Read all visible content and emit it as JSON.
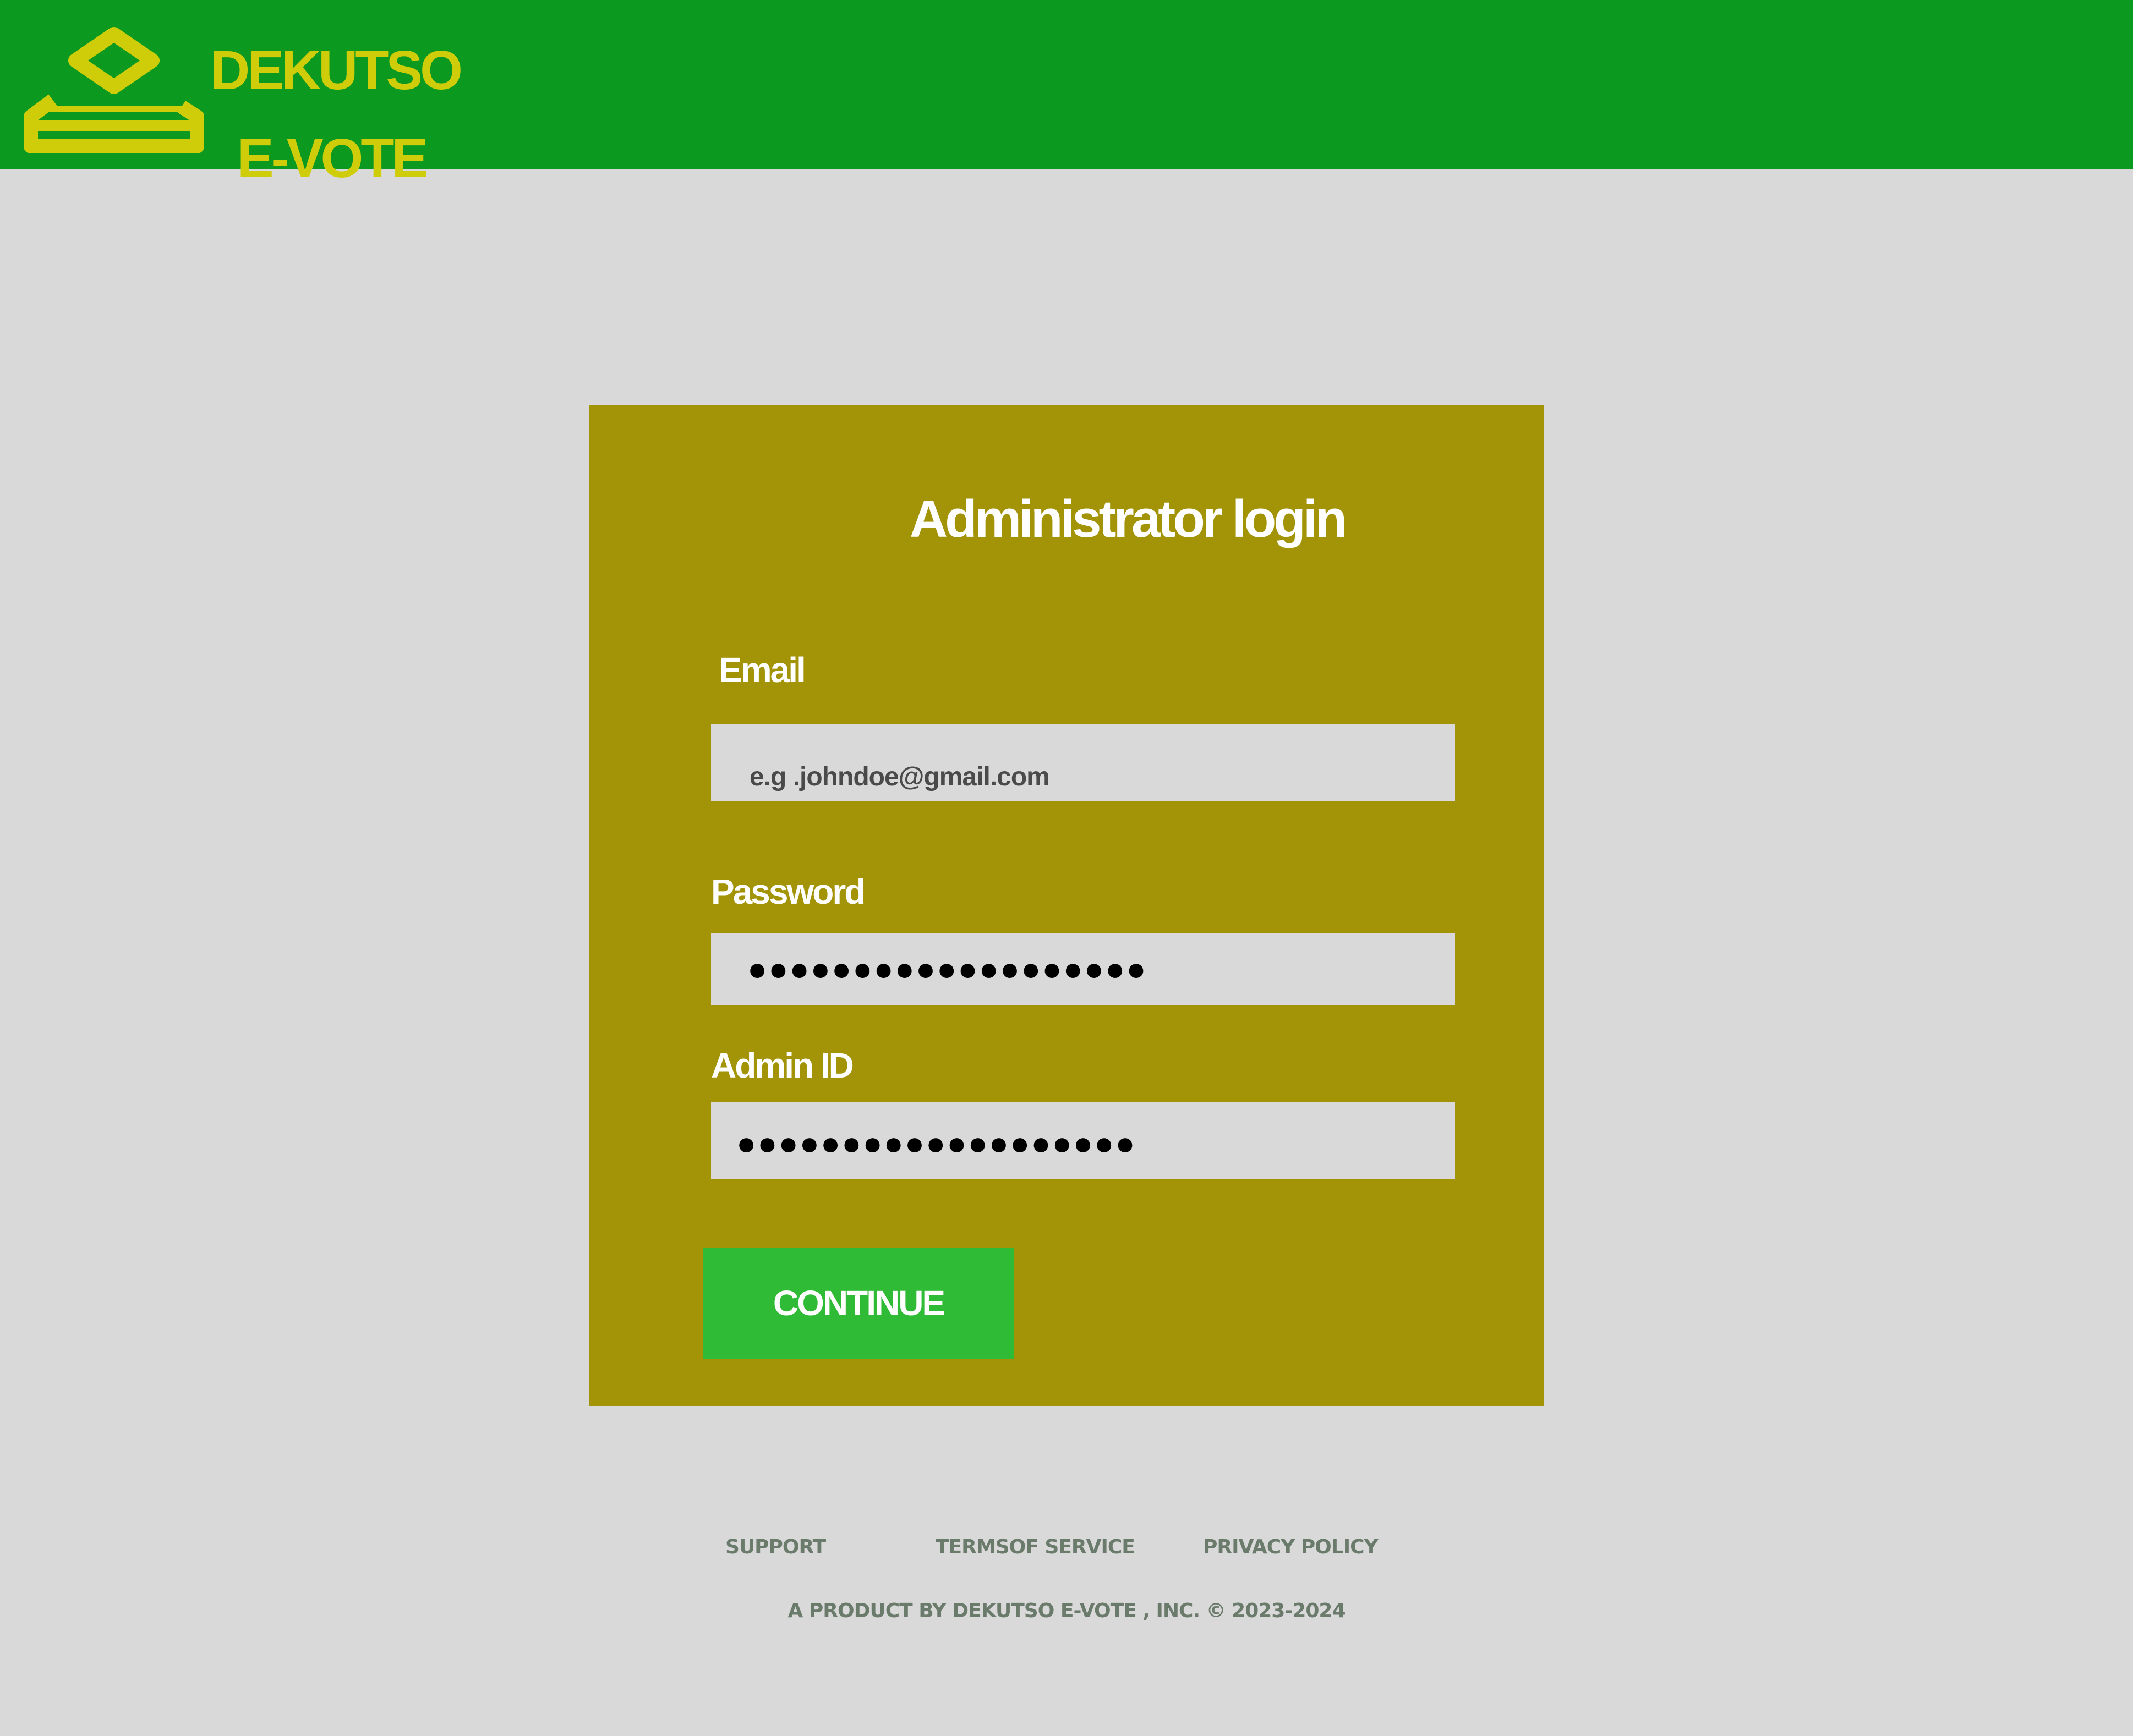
{
  "header": {
    "brand_line1": "DEKUTSO",
    "brand_line2": "E-VOTE",
    "logo_icon": "ballot-box-icon",
    "background_color": "#0c9920",
    "brand_color": "#cfcd0a"
  },
  "login": {
    "title": "Administrator login",
    "email": {
      "label": "Email",
      "placeholder": "e.g .johndoe@gmail.com"
    },
    "password": {
      "label": "Password",
      "value": "●●●●●●●●●●●●●●●●●●●"
    },
    "admin_id": {
      "label": "Admin ID",
      "value": "●●●●●●●●●●●●●●●●●●●"
    },
    "continue_label": "CONTINUE",
    "card_color": "#a29307",
    "button_color": "#2fbb35"
  },
  "footer": {
    "links": [
      "SUPPORT",
      "TERMSOF SERVICE",
      "PRIVACY POLICY"
    ],
    "copyright": "A PRODUCT BY DEKUTSO E-VOTE , INC. © 2023-2024"
  }
}
